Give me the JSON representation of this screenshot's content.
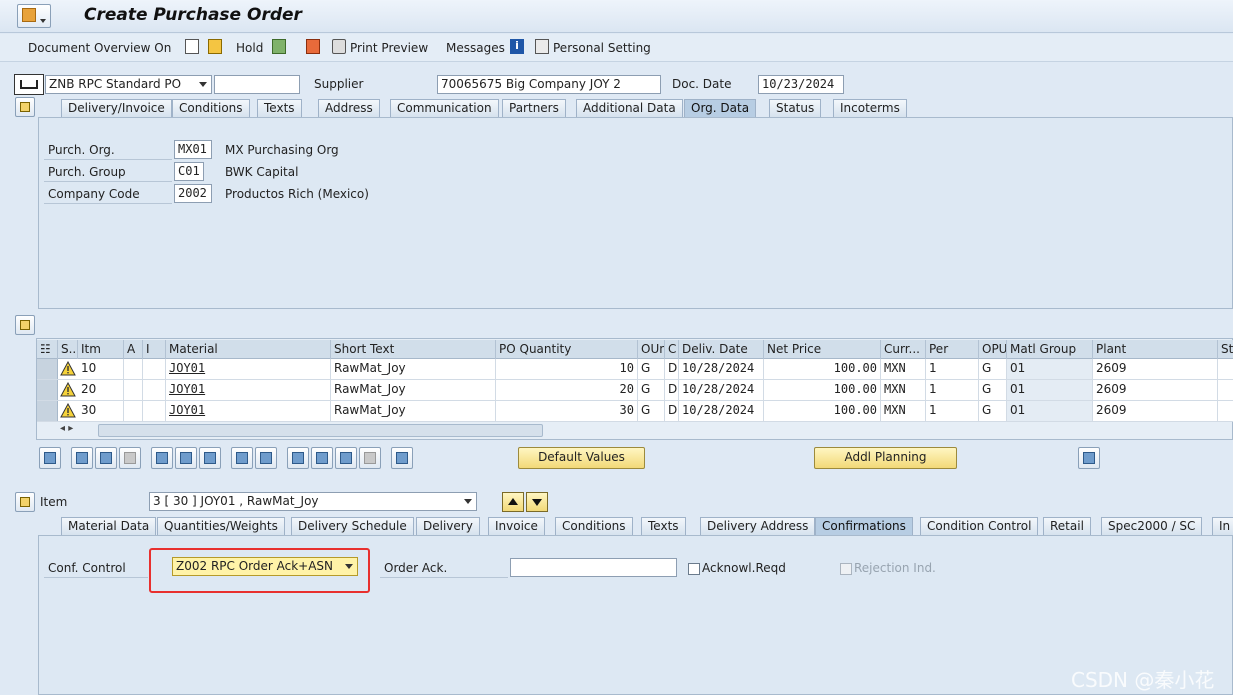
{
  "window": {
    "title": "Create Purchase Order"
  },
  "toolbar": {
    "document_overview": "Document Overview On",
    "hold": "Hold",
    "print_preview": "Print Preview",
    "messages": "Messages",
    "personal_setting": "Personal Setting"
  },
  "header": {
    "doc_type": "ZNB RPC Standard PO",
    "doc_number": "",
    "supplier_label": "Supplier",
    "supplier_value": "70065675 Big Company JOY 2",
    "doc_date_label": "Doc. Date",
    "doc_date_value": "10/23/2024",
    "tabs": [
      "Delivery/Invoice",
      "Conditions",
      "Texts",
      "Address",
      "Communication",
      "Partners",
      "Additional Data",
      "Org. Data",
      "Status",
      "Incoterms"
    ],
    "active_tab": "Org. Data"
  },
  "org_data": {
    "purch_org_label": "Purch. Org.",
    "purch_org_code": "MX01",
    "purch_org_desc": "MX Purchasing Org",
    "purch_group_label": "Purch. Group",
    "purch_group_code": "C01",
    "purch_group_desc": "BWK Capital",
    "company_code_label": "Company Code",
    "company_code_code": "2002",
    "company_code_desc": "Productos Rich (Mexico)"
  },
  "items_table": {
    "columns": [
      "S..",
      "Itm",
      "A",
      "I",
      "Material",
      "Short Text",
      "PO Quantity",
      "OUn",
      "C",
      "Deliv. Date",
      "Net Price",
      "Curr...",
      "Per",
      "OPU",
      "Matl Group",
      "Plant",
      "St"
    ],
    "rows": [
      {
        "itm": "10",
        "material": "JOY01",
        "short_text": "RawMat_Joy",
        "qty": "10",
        "oun": "G",
        "c": "D",
        "deliv": "10/28/2024",
        "price": "100.00",
        "curr": "MXN",
        "per": "1",
        "opu": "G",
        "matl_group": "01",
        "plant": "2609"
      },
      {
        "itm": "20",
        "material": "JOY01",
        "short_text": "RawMat_Joy",
        "qty": "20",
        "oun": "G",
        "c": "D",
        "deliv": "10/28/2024",
        "price": "100.00",
        "curr": "MXN",
        "per": "1",
        "opu": "G",
        "matl_group": "01",
        "plant": "2609"
      },
      {
        "itm": "30",
        "material": "JOY01",
        "short_text": "RawMat_Joy",
        "qty": "30",
        "oun": "G",
        "c": "D",
        "deliv": "10/28/2024",
        "price": "100.00",
        "curr": "MXN",
        "per": "1",
        "opu": "G",
        "matl_group": "01",
        "plant": "2609"
      }
    ]
  },
  "grid_buttons": {
    "default_values": "Default Values",
    "addl_planning": "Addl Planning"
  },
  "item_detail": {
    "item_label": "Item",
    "item_value": "3 [ 30 ] JOY01 , RawMat_Joy",
    "tabs": [
      "Material Data",
      "Quantities/Weights",
      "Delivery Schedule",
      "Delivery",
      "Invoice",
      "Conditions",
      "Texts",
      "Delivery Address",
      "Confirmations",
      "Condition Control",
      "Retail",
      "Spec2000 / SC",
      "In"
    ],
    "active_tab": "Confirmations",
    "conf_control_label": "Conf. Control",
    "conf_control_value": "Z002 RPC Order Ack+ASN",
    "order_ack_label": "Order Ack.",
    "order_ack_value": "",
    "acknowl_reqd_label": "Acknowl.Reqd",
    "rejection_label": "Rejection Ind."
  },
  "watermark": "CSDN @秦小花",
  "colors": {
    "highlight": "#e8302e",
    "field_yellow": "#fff3a8"
  }
}
